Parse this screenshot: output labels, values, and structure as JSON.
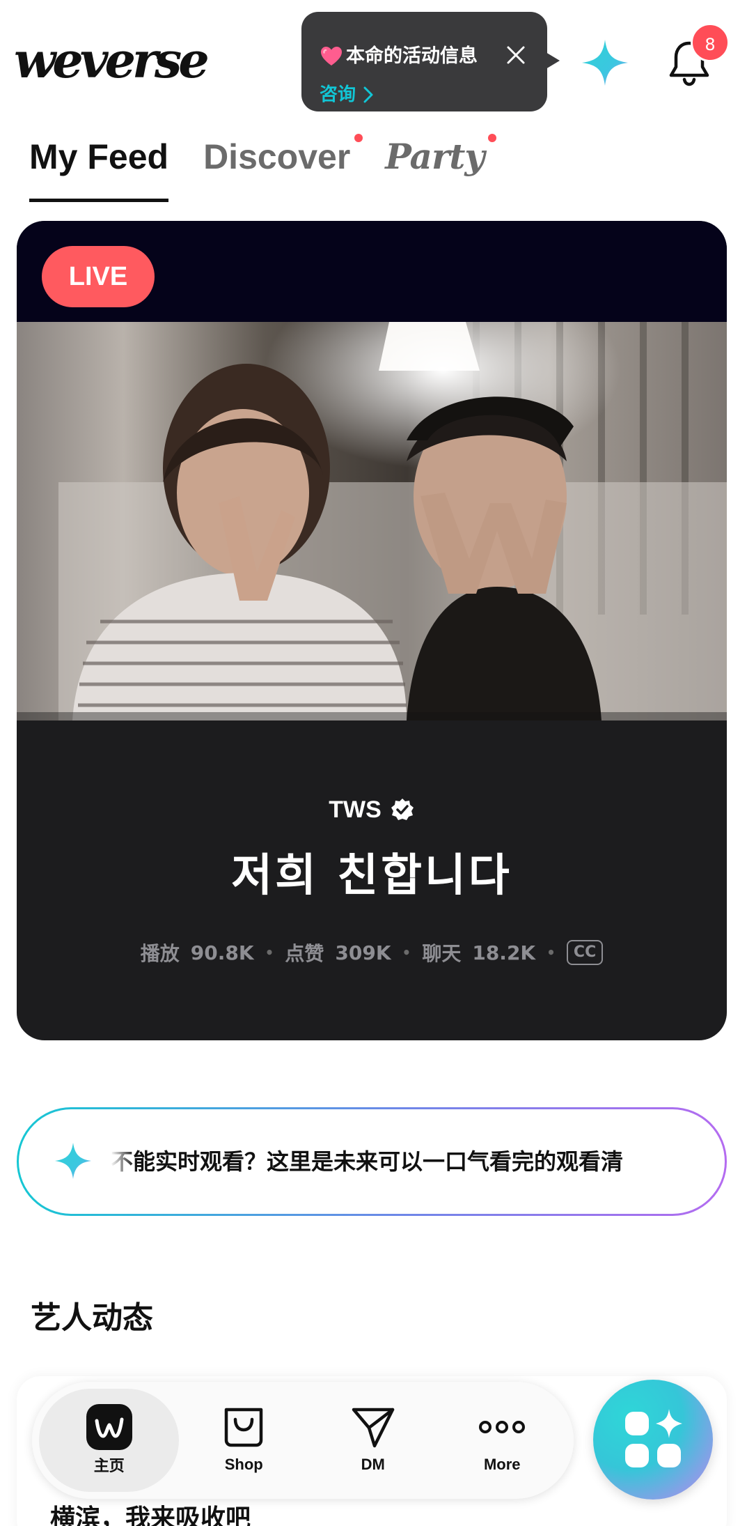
{
  "header": {
    "logo_text": "weverse",
    "tooltip": {
      "title": "本命的活动信息",
      "link_label": "咨询",
      "heart_icon": "heart-icon",
      "close_icon": "close-icon"
    },
    "notification_count": "8",
    "accent_color": "#11c6d6",
    "badge_color": "#ff4d57"
  },
  "tabs": [
    {
      "label": "My Feed",
      "active": true,
      "dot": false
    },
    {
      "label": "Discover",
      "active": false,
      "dot": true
    },
    {
      "label": "Party",
      "active": false,
      "dot": true
    }
  ],
  "live_card": {
    "badge": "LIVE",
    "artist": "TWS",
    "title": "저희 친합니다",
    "stats": {
      "plays_label": "播放",
      "plays_value": "90.8K",
      "likes_label": "点赞",
      "likes_value": "309K",
      "chat_label": "聊天",
      "chat_value": "18.2K",
      "cc": "CC"
    },
    "live_color": "#ff5a5f"
  },
  "promo": {
    "text": "不能实时观看？这里是未来可以一口气看完的观看清"
  },
  "section": {
    "title": "艺人动态"
  },
  "feed_peek": {
    "text": "横滨，我来吸收吧"
  },
  "bottom_nav": {
    "items": [
      {
        "label": "主页",
        "icon": "weverse-home-icon",
        "active": true
      },
      {
        "label": "Shop",
        "icon": "shopping-bag-icon",
        "active": false
      },
      {
        "label": "DM",
        "icon": "paper-plane-icon",
        "active": false
      },
      {
        "label": "More",
        "icon": "more-dots-icon",
        "active": false
      }
    ]
  }
}
